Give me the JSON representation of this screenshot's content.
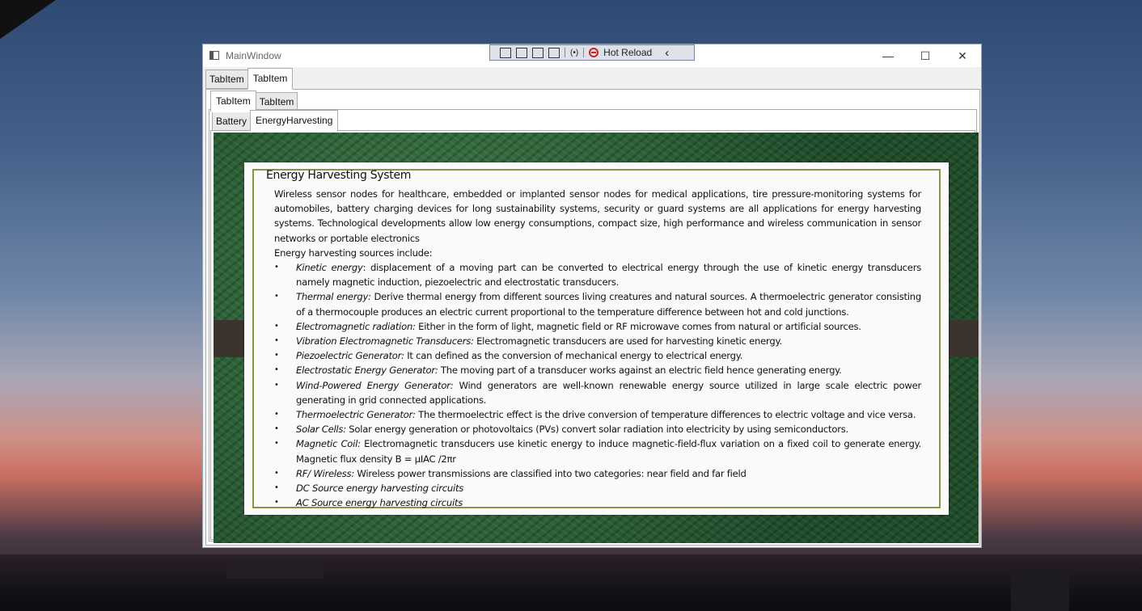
{
  "window": {
    "title": "MainWindow",
    "toolbar_label": "Hot Reload",
    "minimize_glyph": "—",
    "maximize_glyph": "☐",
    "close_glyph": "✕",
    "chevron_glyph": "‹"
  },
  "tabs_level1": [
    "TabItem",
    "TabItem"
  ],
  "tabs_level2": [
    "TabItem",
    "TabItem"
  ],
  "tabs_level3": [
    "Battery",
    "EnergyHarvesting"
  ],
  "document": {
    "title": "Energy Harvesting System",
    "intro": "Wireless sensor nodes for healthcare, embedded or implanted sensor nodes for medical applications, tire pressure-monitoring systems for automobiles, battery charging devices for long sustainability systems, security or guard systems are all applications for energy harvesting systems.  Technological developments allow low energy consumptions, compact size, high performance and wireless communication in sensor networks or portable electronics",
    "sources_heading": "Energy harvesting sources include:",
    "items": [
      {
        "term": "Kinetic energy",
        "text": ": displacement of a moving part can be converted to electrical energy through the use of kinetic energy transducers namely magnetic induction, piezoelectric and electrostatic transducers."
      },
      {
        "term": "Thermal energy:",
        "text": " Derive thermal energy from different sources living creatures and natural sources. A thermoelectric generator consisting of a thermocouple produces an electric current proportional to the temperature difference between hot and cold junctions."
      },
      {
        "term": "Electromagnetic radiation:",
        "text": "  Either in the form of light, magnetic field or RF microwave comes from natural or artificial sources."
      },
      {
        "term": "Vibration Electromagnetic Transducers:",
        "text": " Electromagnetic transducers are used for harvesting kinetic energy."
      },
      {
        "term": "Piezoelectric Generator:",
        "text": "  It can defined as the conversion of mechanical energy to electrical energy."
      },
      {
        "term": "Electrostatic Energy Generator:",
        "text": " The moving part of  a transducer works against an electric field hence generating energy."
      },
      {
        "term": "Wind-Powered Energy Generator:",
        "text": "  Wind generators are well-known renewable energy source utilized in large scale electric power generating in grid connected applications."
      },
      {
        "term": "Thermoelectric Generator:",
        "text": "  The thermoelectric effect is the drive conversion of temperature differences to electric voltage and vice versa."
      },
      {
        "term": "Solar Cells:",
        "text": " Solar energy generation or photovoltaics (PVs) convert solar radiation into electricity by using semiconductors."
      },
      {
        "term": "Magnetic Coil:",
        "text": "  Electromagnetic transducers use kinetic energy to induce magnetic-field-flux variation on a fixed coil to generate energy. Magnetic flux density B = µIAC /2πr"
      },
      {
        "term": "RF/ Wireless:",
        "text": "  Wireless power transmissions are classified into two categories: near field and far field"
      },
      {
        "term": "DC Source energy harvesting circuits",
        "text": ""
      },
      {
        "term": "AC Source energy harvesting circuits",
        "text": ""
      }
    ]
  }
}
